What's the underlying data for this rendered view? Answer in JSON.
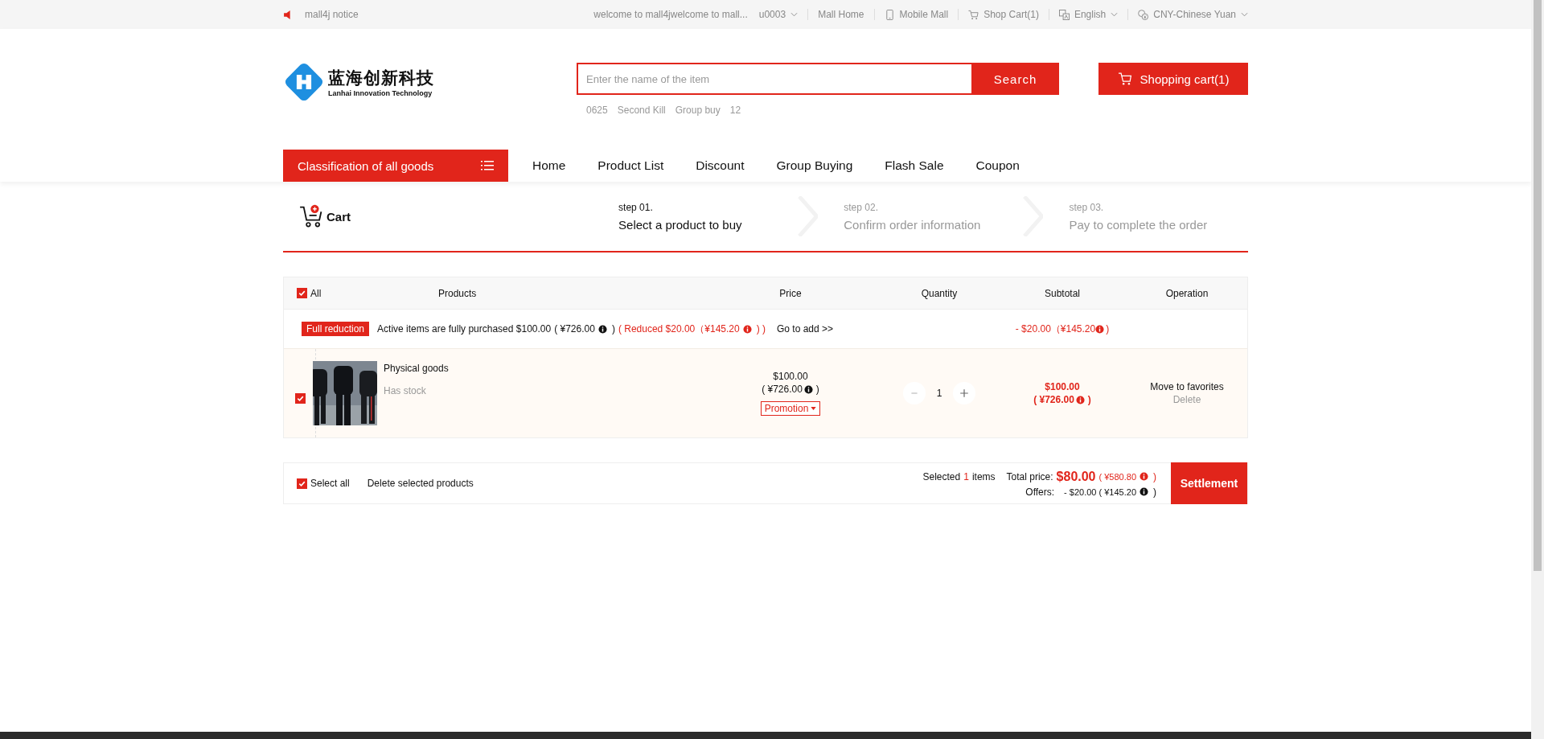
{
  "top_bar": {
    "notice": "mall4j notice",
    "welcome": "welcome to mall4jwelcome to mall...",
    "user": "u0003",
    "links": [
      {
        "label": "Mall Home",
        "kind": "plain",
        "dropdown": false
      },
      {
        "label": "Mobile Mall",
        "kind": "phone",
        "dropdown": false
      },
      {
        "label": "Shop Cart(1)",
        "kind": "cart",
        "dropdown": false
      },
      {
        "label": "English",
        "kind": "language",
        "dropdown": true
      },
      {
        "label": "CNY-Chinese Yuan",
        "kind": "currency",
        "dropdown": true
      }
    ]
  },
  "header": {
    "logo_name": "蓝海创新科技",
    "logo_tagline": "Lanhai Innovation Technology",
    "search": {
      "placeholder": "Enter the name of the item",
      "button": "Search"
    },
    "hot_words": [
      "0625",
      "Second Kill",
      "Group buy",
      "12"
    ],
    "cart_button": "Shopping cart(1)"
  },
  "nav": {
    "category_button": "Classification of all goods",
    "items": [
      "Home",
      "Product List",
      "Discount",
      "Group Buying",
      "Flash Sale",
      "Coupon"
    ]
  },
  "steps_bar": {
    "title": "Cart",
    "steps": [
      {
        "number": "step 01.",
        "label": "Select a product to buy",
        "selected": true
      },
      {
        "number": "step 02.",
        "label": "Confirm order information",
        "selected": false
      },
      {
        "number": "step 03.",
        "label": "Pay to complete the order",
        "selected": false
      }
    ]
  },
  "cart_table": {
    "columns": [
      "All",
      "Products",
      "Price",
      "Quantity",
      "Subtotal",
      "Operation"
    ],
    "all_checked": true,
    "promotion": {
      "badge": "Full reduction",
      "condition": "Active items are fully purchased $100.00",
      "condition_points": "( ¥726.00",
      "condition_close": ")",
      "reduced": "( Reduced $20.00（¥145.20",
      "reduced_close": ") )",
      "link": "Go to add >>",
      "subtotal": "- $20.00（¥145.20",
      "subtotal_close": ")"
    },
    "rows": [
      {
        "checked": true,
        "name": "Physical goods",
        "stock": "Has stock",
        "price": "$100.00",
        "price_points": "( ¥726.00",
        "price_close": ")",
        "promotion": "Promotion",
        "quantity": "1",
        "subtotal": "$100.00",
        "subtotal_points": "( ¥726.00",
        "subtotal_close": ")",
        "actions": [
          "Move to favorites",
          "Delete"
        ]
      }
    ]
  },
  "footer_bar": {
    "select_all": {
      "label": "Select all",
      "checked": true
    },
    "delete": "Delete selected products",
    "selected_prefix": "Selected",
    "selected_count": "1",
    "selected_suffix": "items",
    "total_label": "Total price:",
    "total": "$80.00",
    "total_points": "( ¥580.80",
    "total_close": ")",
    "offers_label": "Offers:",
    "offers": "- $20.00 ( ¥145.20",
    "offers_close": ")",
    "settle": "Settlement"
  }
}
